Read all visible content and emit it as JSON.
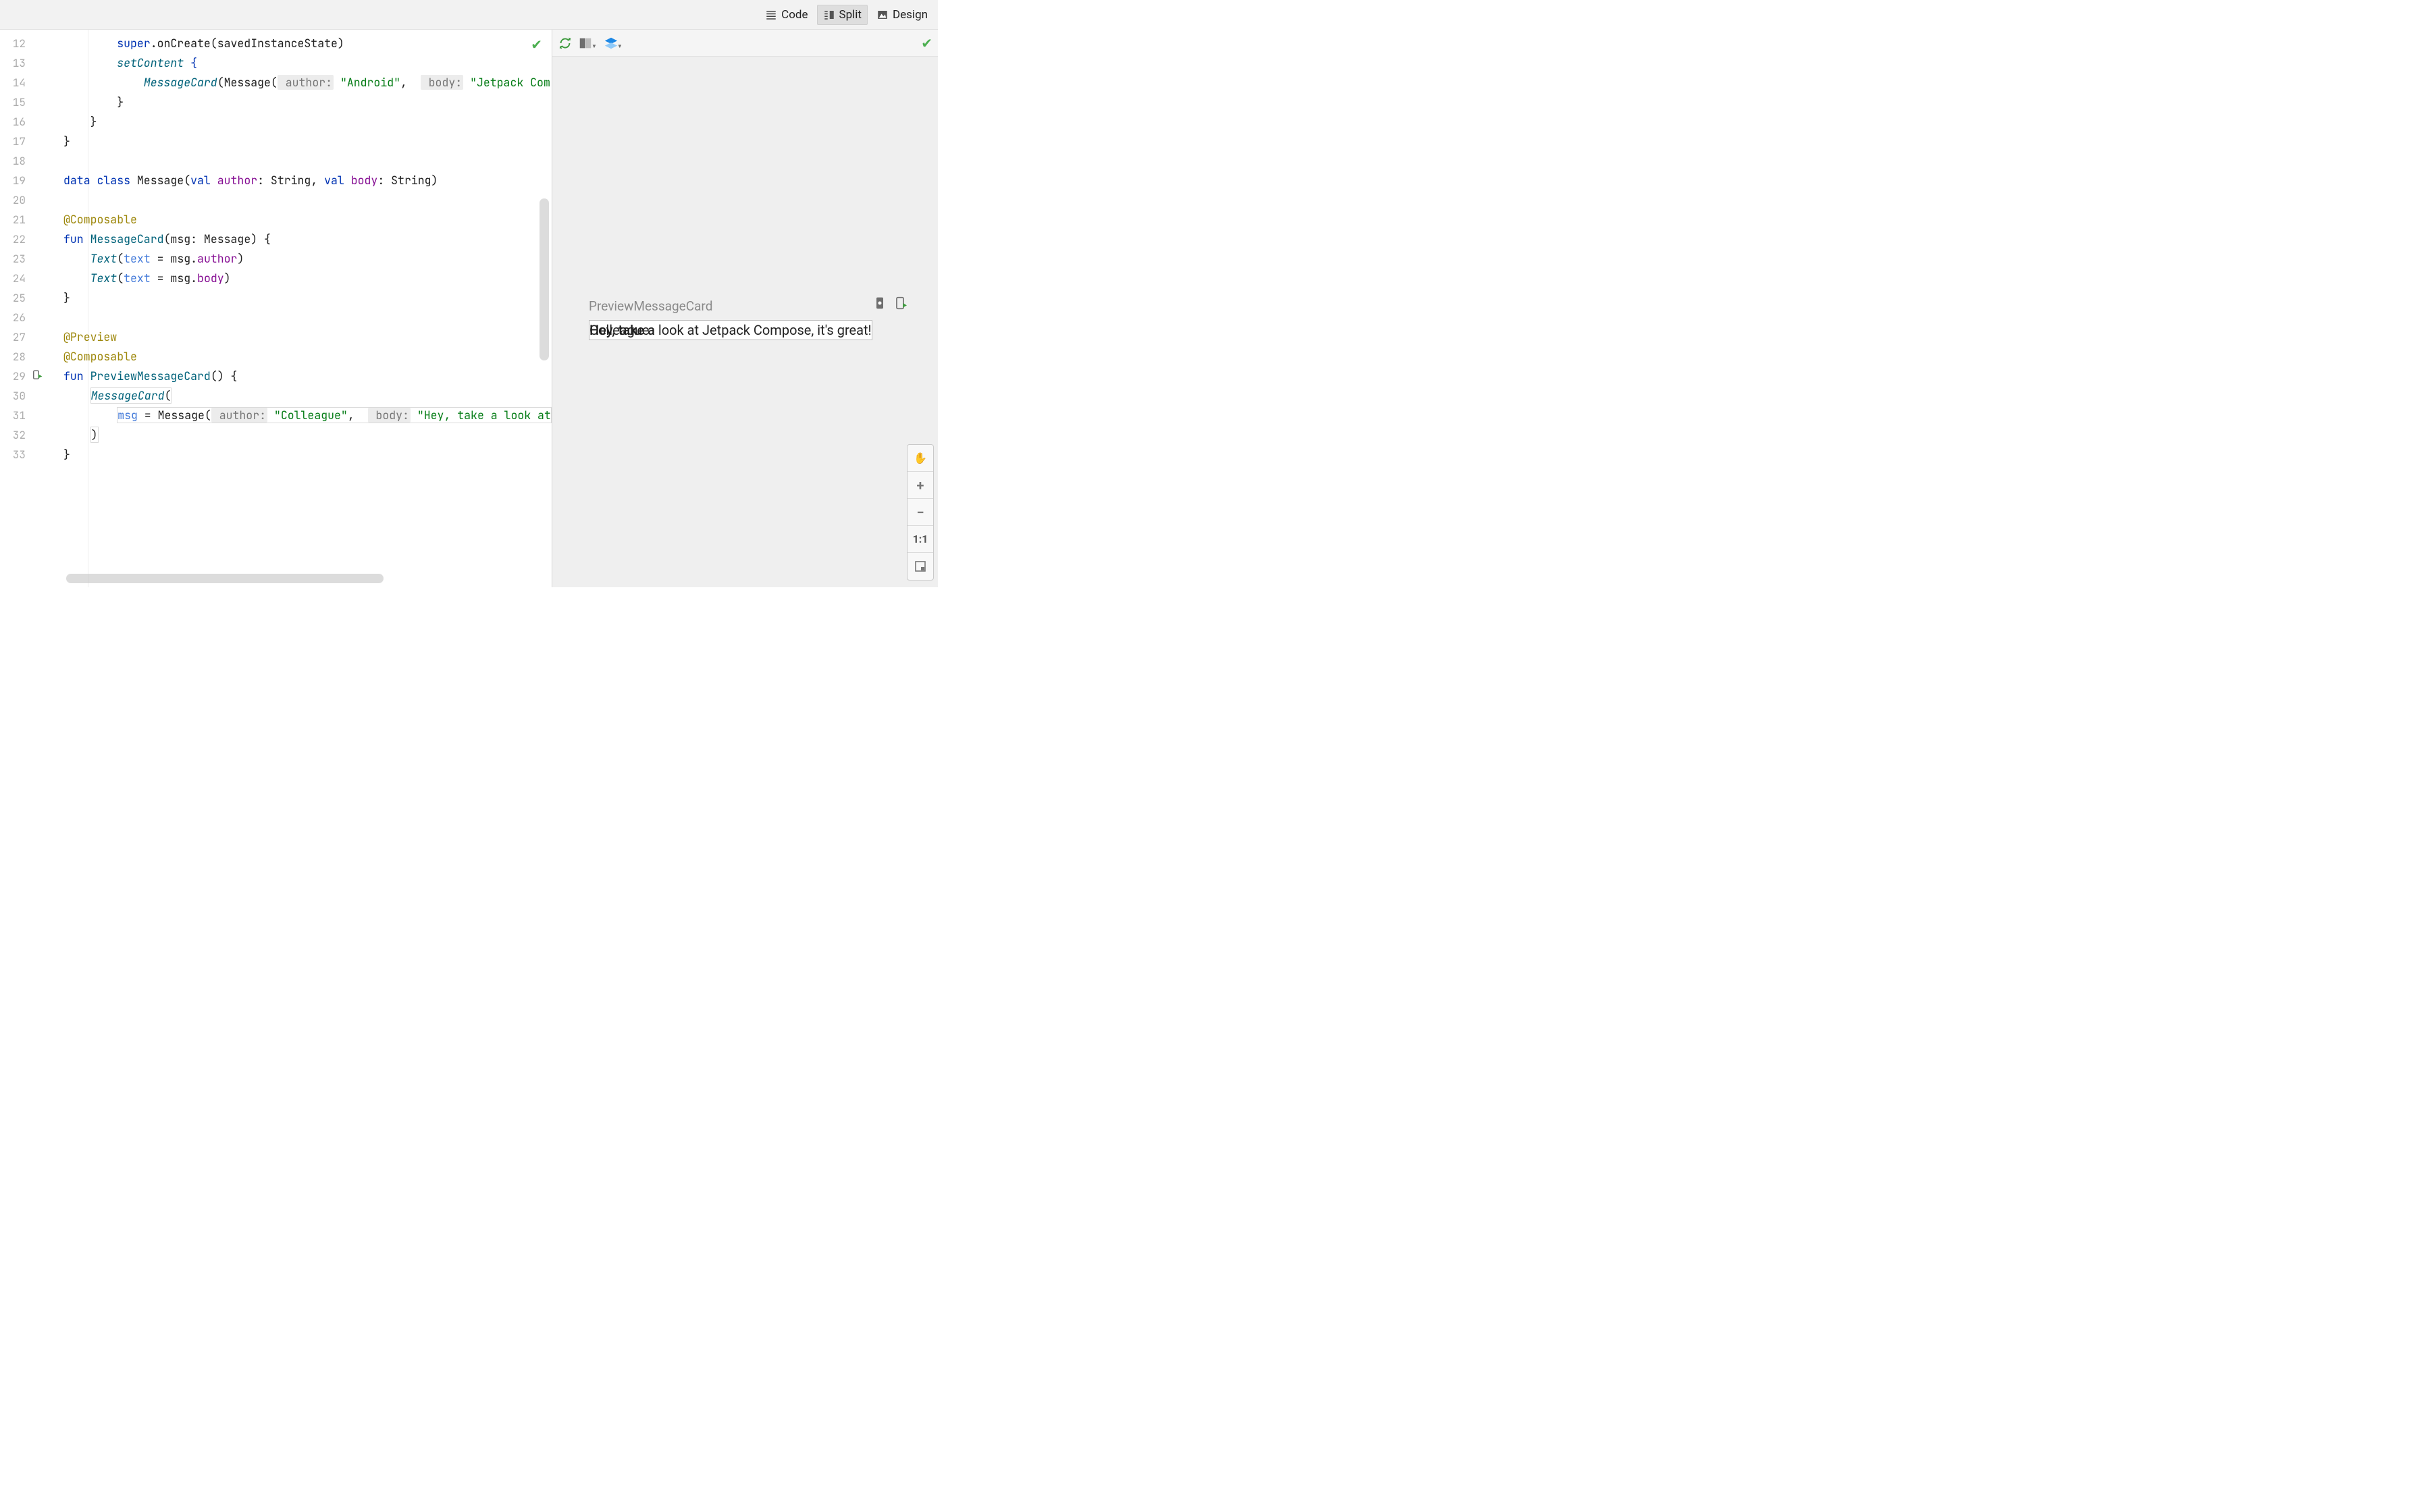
{
  "toolbar": {
    "code": "Code",
    "split": "Split",
    "design": "Design"
  },
  "gutter": {
    "start": 12,
    "end": 33,
    "run_icon_line": 29
  },
  "code": {
    "l12": {
      "a": "super",
      "b": ".onCreate(savedInstanceState)"
    },
    "l13": {
      "a": "setContent",
      "b": " {"
    },
    "l14": {
      "a": "MessageCard",
      "b": "(Message(",
      "p1": " author:",
      "s1": "\"Android\"",
      "c1": ", ",
      "p2": " body:",
      "s2": "\"Jetpack Com"
    },
    "l15": "}",
    "l16": "}",
    "l17": "}",
    "l19": {
      "a": "data class",
      "b": " Message(",
      "c": "val ",
      "d": "author",
      "e": ": String, ",
      "f": "val ",
      "g": "body",
      "h": ": String)"
    },
    "l21": "@Composable",
    "l22": {
      "a": "fun",
      "b": " MessageCard",
      "c": "(msg: Message) {"
    },
    "l23": {
      "a": "Text",
      "b": "(",
      "c": "text",
      "d": " = msg.",
      "e": "author",
      "f": ")"
    },
    "l24": {
      "a": "Text",
      "b": "(",
      "c": "text",
      "d": " = msg.",
      "e": "body",
      "f": ")"
    },
    "l25": "}",
    "l27": "@Preview",
    "l28": "@Composable",
    "l29": {
      "a": "fun",
      "b": " PreviewMessageCard",
      "c": "() {"
    },
    "l30": {
      "a": "MessageCard",
      "b": "("
    },
    "l31": {
      "a": "msg",
      "b": " = Message(",
      "p1": " author:",
      "s1": "\"Colleague\"",
      "c1": ", ",
      "p2": " body:",
      "s2": "\"Hey, take a look at"
    },
    "l32": ")",
    "l33": "}"
  },
  "preview": {
    "label": "PreviewMessageCard",
    "render_back": "Colleague",
    "render_front": "Hey, take a",
    "render_rest": " look at Jetpack Compose, it's great!"
  },
  "zoom": {
    "one": "1:1"
  }
}
